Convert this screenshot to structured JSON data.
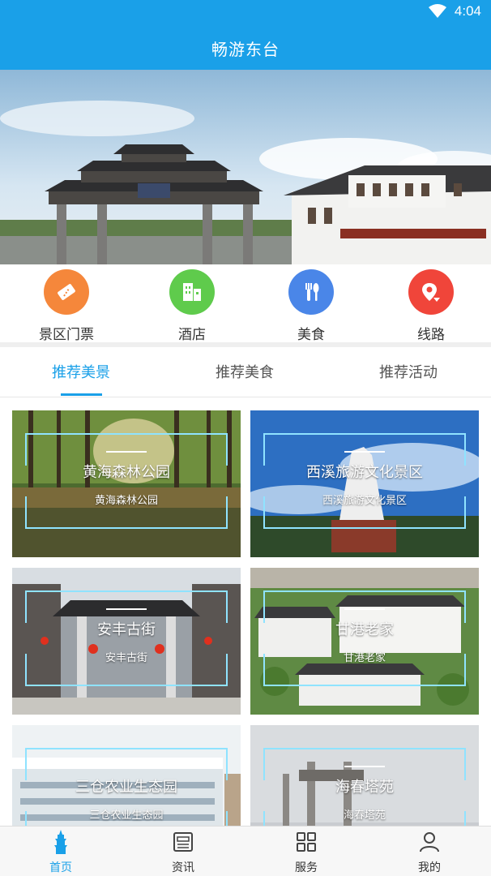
{
  "status_bar": {
    "time": "4:04",
    "icons": [
      "wifi-icon",
      "battery-icon"
    ]
  },
  "app_bar": {
    "title": "畅游东台"
  },
  "quick_menu": [
    {
      "label": "景区门票",
      "icon": "ticket-icon",
      "color": "#f5873b"
    },
    {
      "label": "酒店",
      "icon": "building-icon",
      "color": "#5fcb4c"
    },
    {
      "label": "美食",
      "icon": "fork-spoon-icon",
      "color": "#4a86e8"
    },
    {
      "label": "线路",
      "icon": "route-pin-icon",
      "color": "#f0453a"
    }
  ],
  "tabs": [
    {
      "label": "推荐美景",
      "active": true
    },
    {
      "label": "推荐美食",
      "active": false
    },
    {
      "label": "推荐活动",
      "active": false
    }
  ],
  "cards": [
    {
      "title": "黄海森林公园",
      "subtitle": "黄海森林公园"
    },
    {
      "title": "西溪旅游文化景区",
      "subtitle": "西溪旅游文化景区"
    },
    {
      "title": "安丰古街",
      "subtitle": "安丰古街"
    },
    {
      "title": "甘港老家",
      "subtitle": "甘港老家"
    },
    {
      "title": "三仓农业生态园",
      "subtitle": "三仓农业生态园"
    },
    {
      "title": "海春塔苑",
      "subtitle": "海春塔苑"
    }
  ],
  "bottom_nav": [
    {
      "label": "首页",
      "icon": "pagoda-icon",
      "active": true
    },
    {
      "label": "资讯",
      "icon": "news-icon",
      "active": false
    },
    {
      "label": "服务",
      "icon": "grid-icon",
      "active": false
    },
    {
      "label": "我的",
      "icon": "user-icon",
      "active": false
    }
  ],
  "accent_color": "#1aa0e8"
}
